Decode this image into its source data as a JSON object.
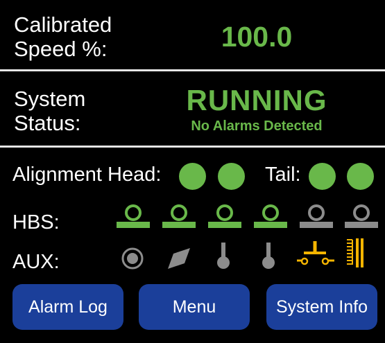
{
  "speed": {
    "label_line1": "Calibrated",
    "label_line2": "Speed %:",
    "value": "100.0"
  },
  "status": {
    "label_line1": "System",
    "label_line2": "Status:",
    "value": "RUNNING",
    "detail": "No Alarms Detected"
  },
  "alignment": {
    "head_label": "Alignment Head:",
    "tail_label": "Tail:"
  },
  "hbs": {
    "label": "HBS:",
    "states": [
      "green",
      "green",
      "green",
      "green",
      "gray",
      "gray"
    ]
  },
  "aux": {
    "label": "AUX:",
    "icons": [
      "target-icon",
      "parallelogram-icon",
      "probe-icon",
      "probe-icon",
      "switch-icon",
      "relay-icon"
    ]
  },
  "buttons": {
    "alarm_log": "Alarm Log",
    "menu": "Menu",
    "system_info": "System Info"
  },
  "colors": {
    "ok": "#69b84a",
    "inactive": "#8c8c8c",
    "warn": "#f5b400",
    "button": "#1b3f9a"
  }
}
